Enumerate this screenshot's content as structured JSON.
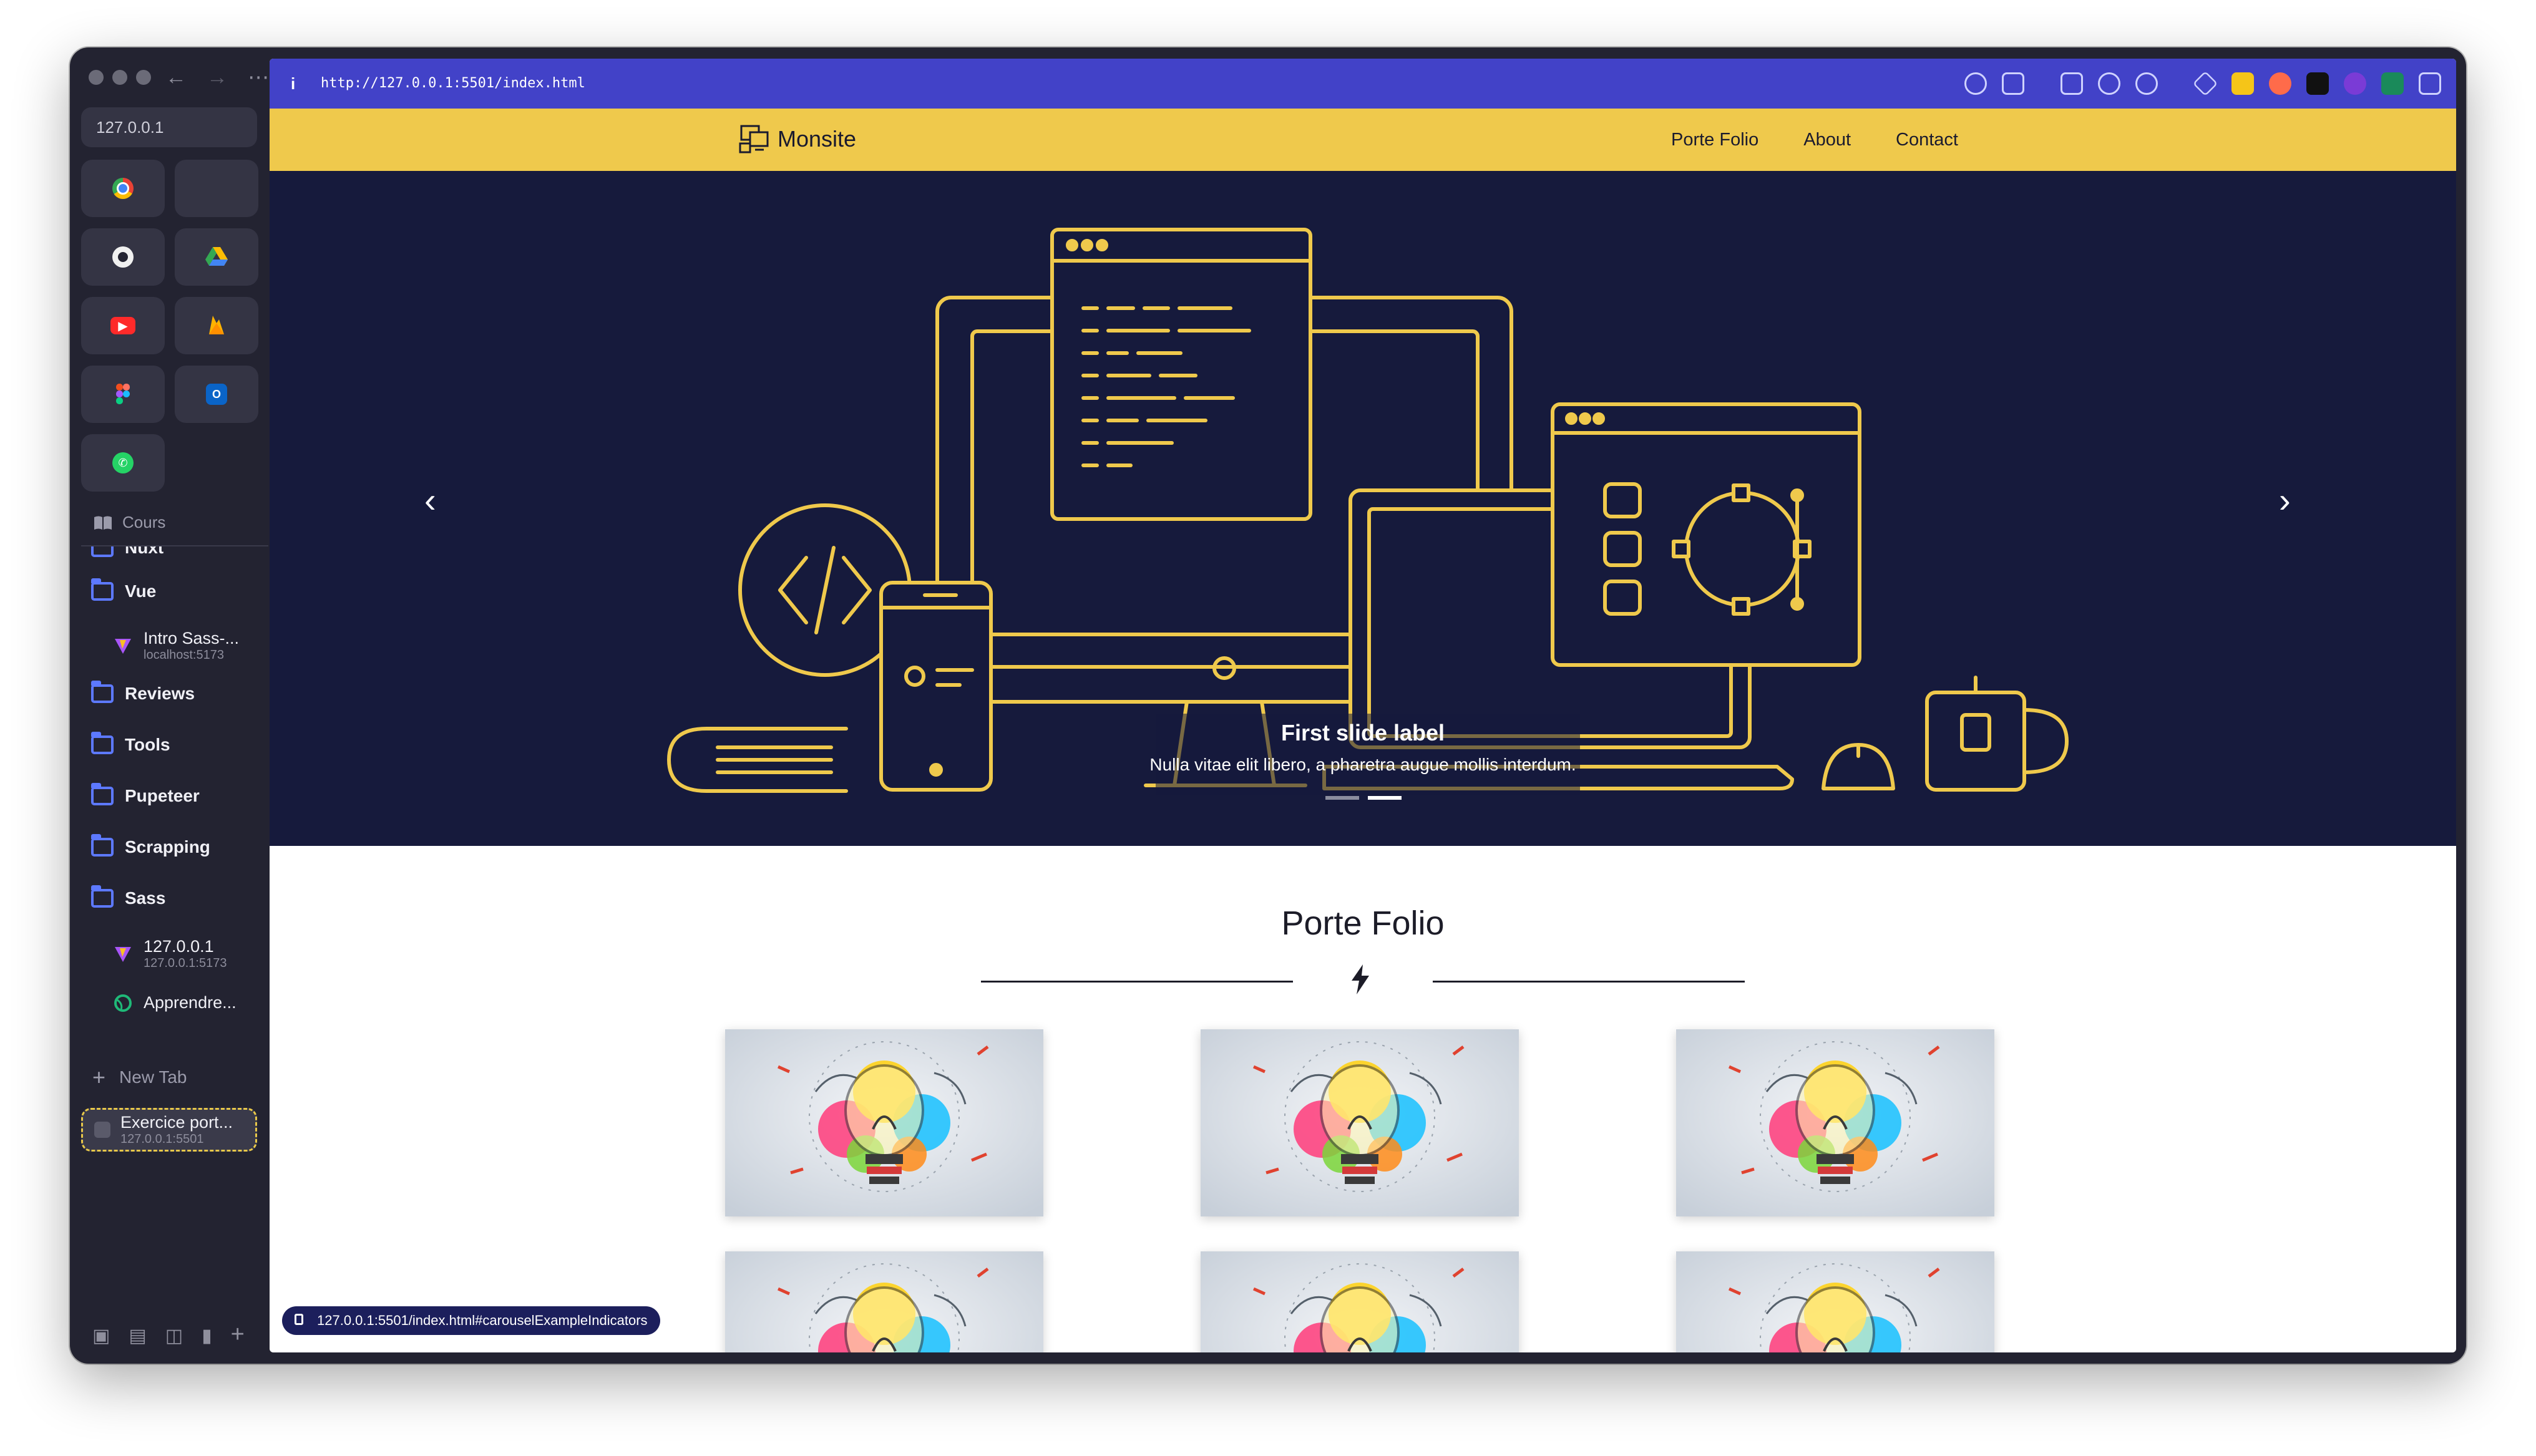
{
  "sidebar": {
    "address": "127.0.0.1",
    "section_label": "Cours",
    "folders": [
      {
        "label": "Nuxt"
      },
      {
        "label": "Vue"
      },
      {
        "label": "Reviews"
      },
      {
        "label": "Tools"
      },
      {
        "label": "Pupeteer"
      },
      {
        "label": "Scrapping"
      },
      {
        "label": "Sass"
      }
    ],
    "tabs": [
      {
        "title": "Intro Sass-...",
        "subtitle": "localhost:5173"
      },
      {
        "title": "127.0.0.1",
        "subtitle": "127.0.0.1:5173"
      },
      {
        "title": "Apprendre..."
      }
    ],
    "new_tab_label": "New Tab",
    "active_tab": {
      "title": "Exercice port...",
      "subtitle": "127.0.0.1:5501"
    }
  },
  "browser": {
    "url": "http://127.0.0.1:5501/index.html",
    "status_url": "127.0.0.1:5501/index.html#carouselExampleIndicators"
  },
  "site": {
    "brand": "Monsite",
    "nav": [
      "Porte Folio",
      "About",
      "Contact"
    ],
    "carousel": {
      "title": "First slide label",
      "text": "Nulla vitae elit libero, a pharetra augue mollis interdum.",
      "slide_count": 2,
      "active_index": 1
    },
    "section_title": "Porte Folio"
  },
  "colors": {
    "accent_yellow": "#efc94c",
    "hero_bg": "#161a3c",
    "urlbar": "#4242c8",
    "sidebar_bg": "#232331",
    "folder_blue": "#5d79ff"
  }
}
